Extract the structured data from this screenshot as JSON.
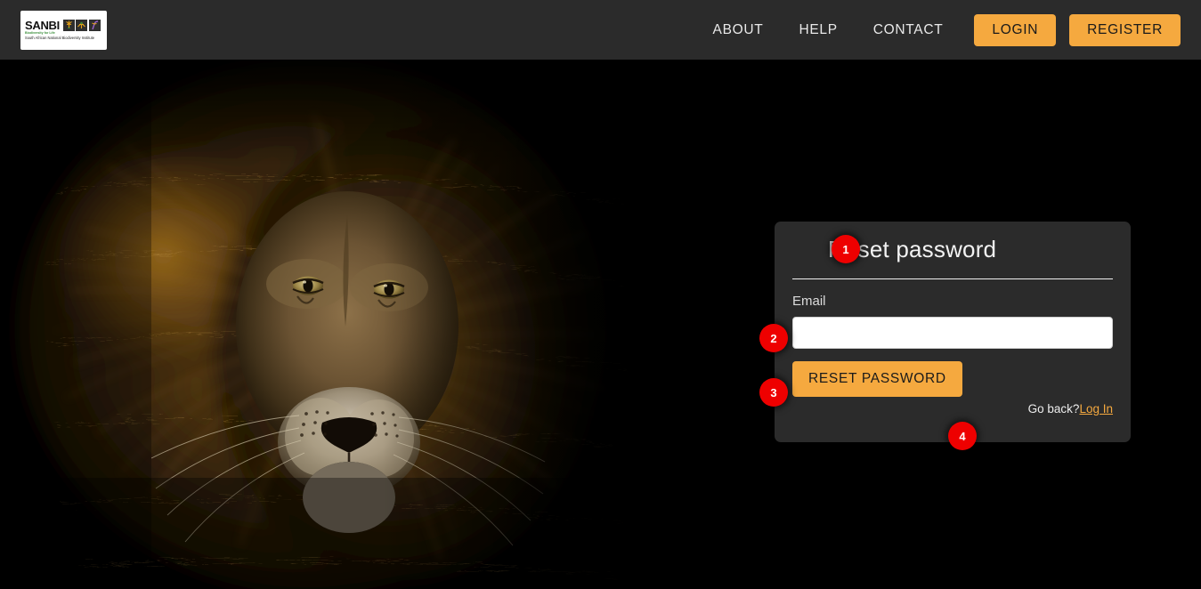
{
  "header": {
    "logo": {
      "name": "sanbi-logo",
      "wordmark": "SANBI",
      "tagline": "Biodiversity for Life",
      "full_name": "South African National Biodiversity Institute"
    },
    "nav_links": [
      {
        "label": "ABOUT",
        "name": "nav-link-about"
      },
      {
        "label": "HELP",
        "name": "nav-link-help"
      },
      {
        "label": "CONTACT",
        "name": "nav-link-contact"
      }
    ],
    "login_label": "LOGIN",
    "register_label": "REGISTER"
  },
  "hero": {
    "alt": "lion-photograph",
    "description": "Close-up photograph of a male lion's face with a full mane against a black background"
  },
  "card": {
    "title": "Reset password",
    "email_label": "Email",
    "email_value": "",
    "email_placeholder": "",
    "submit_label": "RESET PASSWORD",
    "goback_text": "Go back?",
    "login_link_label": "Log In"
  },
  "annotations": [
    {
      "number": "1",
      "target": "Reset password title"
    },
    {
      "number": "2",
      "target": "Email input field"
    },
    {
      "number": "3",
      "target": "Reset password button"
    },
    {
      "number": "4",
      "target": "Log In link"
    }
  ],
  "colors": {
    "accent_orange": "#f5a93f",
    "badge_red": "#ee0000",
    "header_bg": "#2b2b2b",
    "card_bg": "#2b2b2b",
    "page_bg": "#000000"
  }
}
